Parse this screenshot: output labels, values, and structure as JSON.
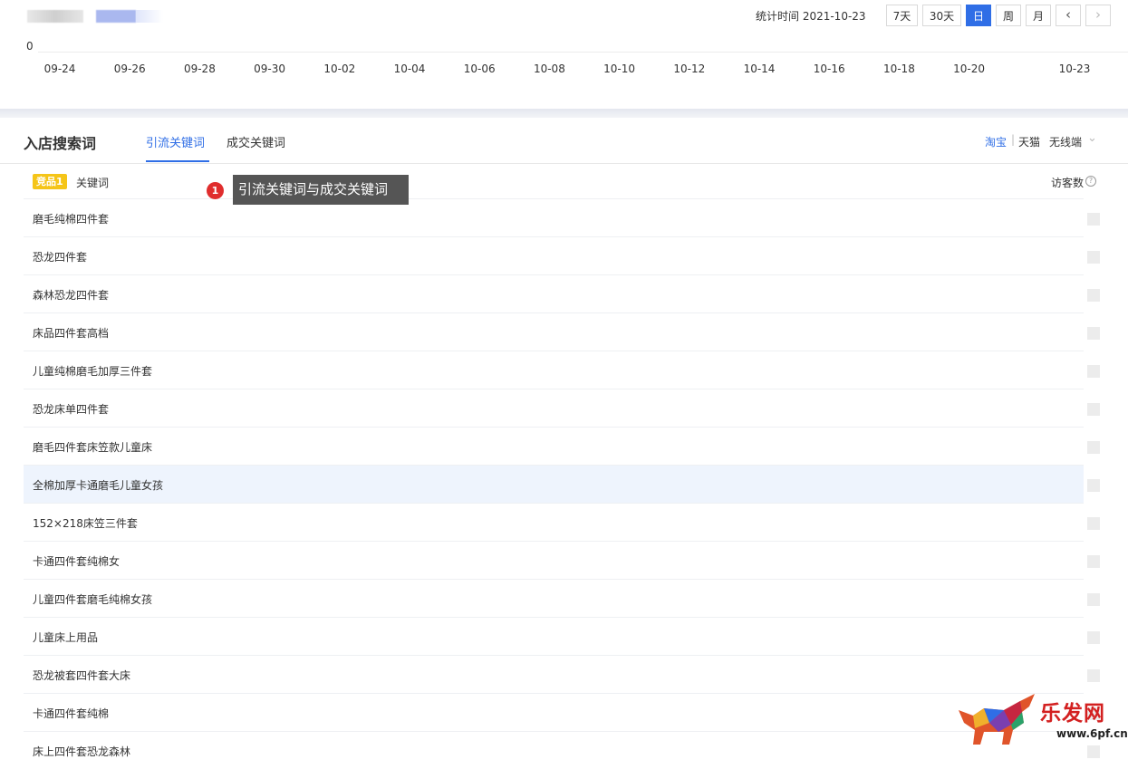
{
  "header": {
    "stat_time": "统计时间 2021-10-23",
    "range_buttons": [
      "7天",
      "30天",
      "日",
      "周",
      "月"
    ],
    "active_range": "日",
    "prev_icon": "chevron-left-icon",
    "next_icon": "chevron-right-icon"
  },
  "chart": {
    "y_zero": "0",
    "x_ticks": [
      "09-24",
      "09-26",
      "09-28",
      "09-30",
      "10-02",
      "10-04",
      "10-06",
      "10-08",
      "10-10",
      "10-12",
      "10-14",
      "10-16",
      "10-18",
      "10-20",
      "10-23"
    ]
  },
  "section": {
    "title": "入店搜索词",
    "tabs": [
      "引流关键词",
      "成交关键词"
    ],
    "active_tab": "引流关键词",
    "platforms": [
      "淘宝",
      "天猫"
    ],
    "platform_sep": "|",
    "device": "无线端",
    "device_dropdown_icon": "chevron-down-icon"
  },
  "table": {
    "badge": "竞品1",
    "col_keyword": "关键词",
    "col_visitors": "访客数",
    "help_icon": "question-circle-icon",
    "rows": [
      "磨毛纯棉四件套",
      "恐龙四件套",
      "森林恐龙四件套",
      "床品四件套高档",
      "儿童纯棉磨毛加厚三件套",
      "恐龙床单四件套",
      "磨毛四件套床笠款儿童床",
      "全棉加厚卡通磨毛儿童女孩",
      "152×218床笠三件套",
      "卡通四件套纯棉女",
      "儿童四件套磨毛纯棉女孩",
      "儿童床上用品",
      "恐龙被套四件套大床",
      "卡通四件套纯棉",
      "床上四件套恐龙森林"
    ],
    "highlighted_row": 7
  },
  "annotation": {
    "number": "1",
    "text": "引流关键词与成交关键词"
  },
  "watermark": {
    "logo": "bull-logo-icon",
    "site": "乐发网",
    "url": "www.6pf.cn"
  }
}
